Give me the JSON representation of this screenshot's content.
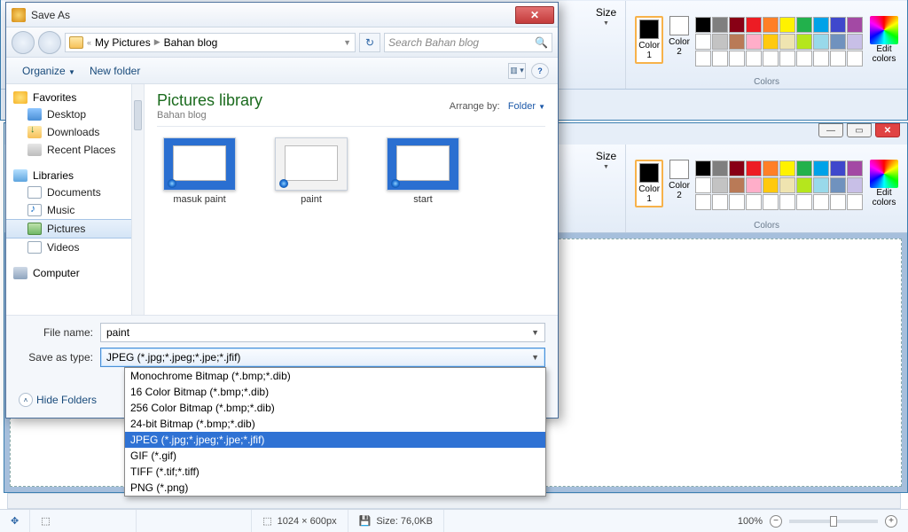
{
  "paint": {
    "size_label": "Size",
    "color1_label": "Color\n1",
    "color2_label": "Color\n2",
    "colors_group": "Colors",
    "edit_colors": "Edit\ncolors",
    "palette_row1": [
      "#000000",
      "#7f7f7f",
      "#880015",
      "#ed1c24",
      "#ff7f27",
      "#fff200",
      "#22b14c",
      "#00a2e8",
      "#3f48cc",
      "#a349a4"
    ],
    "palette_row2": [
      "#ffffff",
      "#c3c3c3",
      "#b97a57",
      "#ffaec9",
      "#ffc90e",
      "#efe4b0",
      "#b5e61d",
      "#99d9ea",
      "#7092be",
      "#c8bfe7"
    ],
    "color1_value": "#000000",
    "color2_value": "#ffffff"
  },
  "statusbar": {
    "move_icon": "✥",
    "sel_icon": "⬚",
    "dim_icon": "⬚",
    "dimensions": "1024 × 600px",
    "disk_icon": "💾",
    "filesize": "Size: 76,0KB",
    "zoom": "100%"
  },
  "saveas": {
    "title": "Save As",
    "breadcrumb_prefix": "«",
    "breadcrumb1": "My Pictures",
    "breadcrumb2": "Bahan blog",
    "search_placeholder": "Search Bahan blog",
    "organize": "Organize",
    "newfolder": "New folder",
    "tree": {
      "favorites": "Favorites",
      "desktop": "Desktop",
      "downloads": "Downloads",
      "recent": "Recent Places",
      "libraries": "Libraries",
      "documents": "Documents",
      "music": "Music",
      "pictures": "Pictures",
      "videos": "Videos",
      "computer": "Computer"
    },
    "lib_title": "Pictures library",
    "lib_sub": "Bahan blog",
    "arrange_label": "Arrange by:",
    "arrange_value": "Folder",
    "thumbs": [
      "masuk paint",
      "paint",
      "start"
    ],
    "fn_label": "File name:",
    "fn_value": "paint",
    "type_label": "Save as type:",
    "type_value": "JPEG (*.jpg;*.jpeg;*.jpe;*.jfif)",
    "hide_folders": "Hide Folders",
    "type_options": [
      "Monochrome Bitmap (*.bmp;*.dib)",
      "16 Color Bitmap (*.bmp;*.dib)",
      "256 Color Bitmap (*.bmp;*.dib)",
      "24-bit Bitmap (*.bmp;*.dib)",
      "JPEG (*.jpg;*.jpeg;*.jpe;*.jfif)",
      "GIF (*.gif)",
      "TIFF (*.tif;*.tiff)",
      "PNG (*.png)"
    ],
    "type_selected_index": 4
  }
}
